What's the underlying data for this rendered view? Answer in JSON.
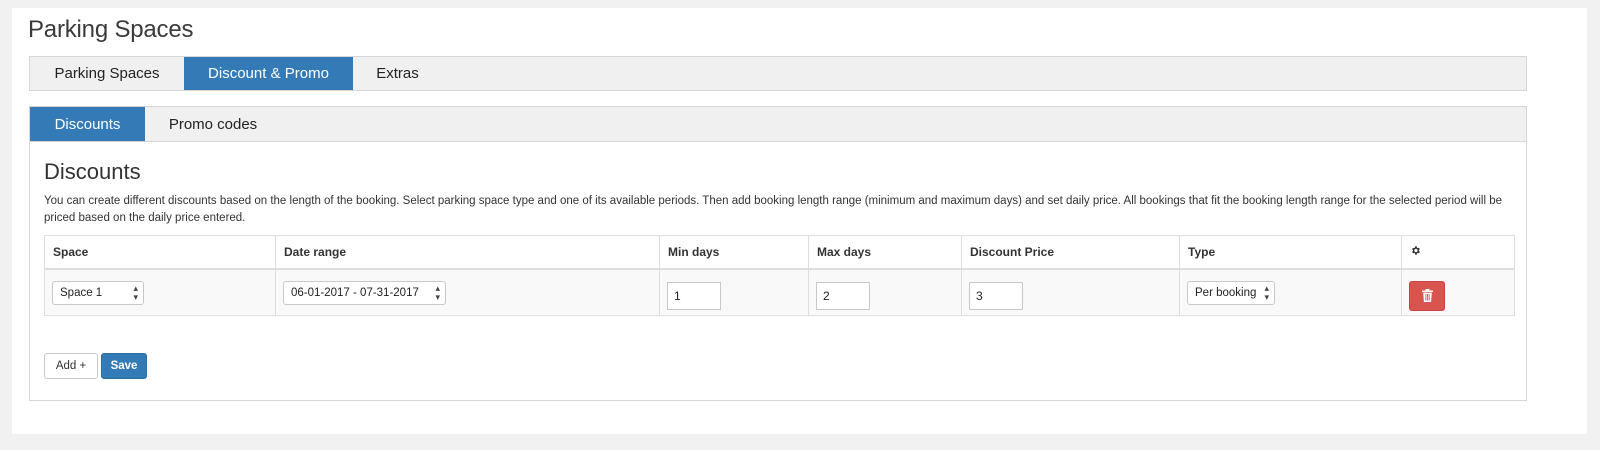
{
  "page": {
    "title": "Parking Spaces"
  },
  "main_tabs": [
    {
      "label": "Parking Spaces",
      "active": false
    },
    {
      "label": "Discount & Promo",
      "active": true
    },
    {
      "label": "Extras",
      "active": false
    }
  ],
  "sub_tabs": [
    {
      "label": "Discounts",
      "active": true
    },
    {
      "label": "Promo codes",
      "active": false
    }
  ],
  "section": {
    "title": "Discounts",
    "description": "You can create different discounts based on the length of the booking. Select parking space type and one of its available periods. Then add booking length range (minimum and maximum days) and set daily price. All bookings that fit the booking length range for the selected period will be priced based on the daily price entered."
  },
  "table": {
    "headers": {
      "space": "Space",
      "date_range": "Date range",
      "min_days": "Min days",
      "max_days": "Max days",
      "discount_price": "Discount Price",
      "type": "Type",
      "actions_icon": "gear-icon"
    },
    "rows": [
      {
        "space": "Space 1",
        "date_range": "06-01-2017 - 07-31-2017",
        "min_days": "1",
        "max_days": "2",
        "discount_price": "3",
        "type": "Per booking",
        "delete_icon": "trash-icon"
      }
    ]
  },
  "buttons": {
    "add": "Add +",
    "save": "Save"
  },
  "colors": {
    "accent": "#337ab7",
    "danger": "#d9534f",
    "tab_bar_bg": "#f0f0f0",
    "page_bg": "#f1f1f1"
  }
}
